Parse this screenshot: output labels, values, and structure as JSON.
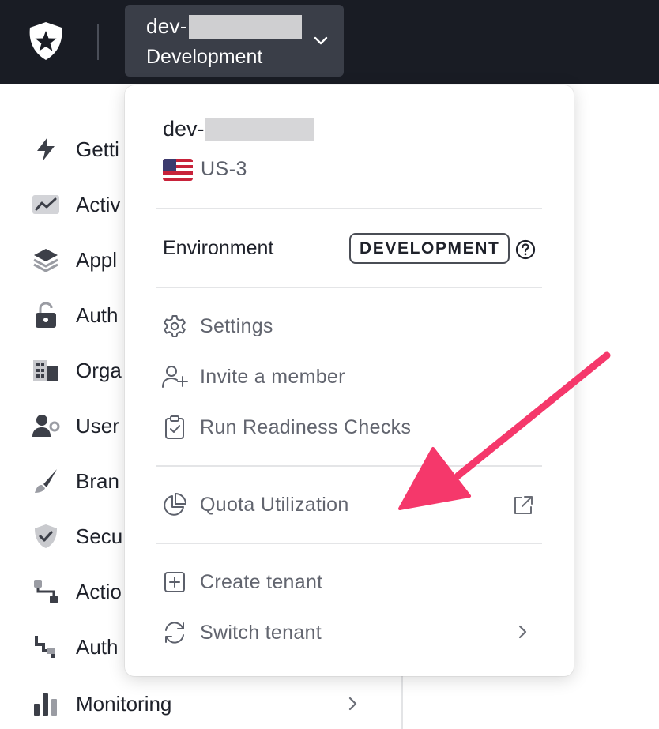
{
  "topbar": {
    "tenant_name_prefix": "dev-",
    "tenant_environment": "Development"
  },
  "sidebar": {
    "items": [
      {
        "label": "Getti",
        "icon": "lightning-icon"
      },
      {
        "label": "Activ",
        "icon": "activity-chart-icon"
      },
      {
        "label": "Appl",
        "icon": "layers-icon"
      },
      {
        "label": "Auth",
        "icon": "unlock-icon"
      },
      {
        "label": "Orga",
        "icon": "buildings-icon"
      },
      {
        "label": "User",
        "icon": "user-gear-icon"
      },
      {
        "label": "Bran",
        "icon": "brush-icon"
      },
      {
        "label": "Secu",
        "icon": "shield-check-icon"
      },
      {
        "label": "Actio",
        "icon": "flow-icon"
      },
      {
        "label": "Auth",
        "icon": "pipeline-icon"
      },
      {
        "label": "Monitoring",
        "icon": "bar-chart-icon"
      }
    ]
  },
  "menu": {
    "tenant_name_prefix": "dev-",
    "region": "US-3",
    "environment_label": "Environment",
    "environment_badge": "DEVELOPMENT",
    "items": {
      "settings": "Settings",
      "invite": "Invite a member",
      "readiness": "Run Readiness Checks",
      "quota": "Quota Utilization",
      "create_tenant": "Create tenant",
      "switch_tenant": "Switch tenant"
    }
  },
  "colors": {
    "topbar_bg": "#191c24",
    "tenant_button_bg": "#3a3e48",
    "annotation_arrow": "#f5386b"
  }
}
